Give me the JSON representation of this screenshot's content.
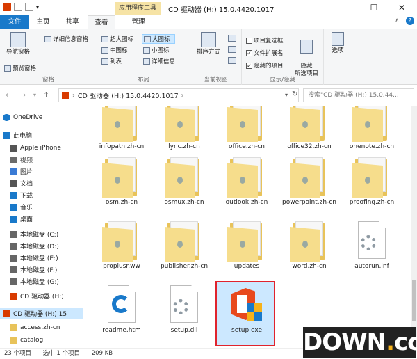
{
  "titlebar": {
    "context_tab": "应用程序工具",
    "title": "CD 驱动器 (H:) 15.0.4420.1017",
    "minimize": "—",
    "maximize": "☐",
    "close": "✕"
  },
  "tabs": {
    "file": "文件",
    "home": "主页",
    "share": "共享",
    "view": "查看",
    "manage": "管理"
  },
  "ribbon": {
    "pane": {
      "nav_pane": "导航窗格",
      "preview_pane": "预览窗格",
      "details_pane": "详细信息窗格",
      "label": "窗格"
    },
    "layout": {
      "extra_large": "超大图标",
      "large": "大图标",
      "medium": "中图标",
      "small": "小图标",
      "list": "列表",
      "details": "详细信息",
      "label": "布局"
    },
    "current_view": {
      "sort_by": "排序方式",
      "label": "当前视图"
    },
    "show_hide": {
      "item_checkboxes": "项目复选框",
      "file_extensions": "文件扩展名",
      "hidden_items": "隐藏的项目",
      "hide_selected": "隐藏\n所选项目",
      "label": "显示/隐藏"
    },
    "options": "选项"
  },
  "address": {
    "path": "CD 驱动器 (H:) 15.0.4420.1017",
    "search_placeholder": "搜索\"CD 驱动器 (H:) 15.0.44..."
  },
  "nav": {
    "items": [
      {
        "label": "OneDrive"
      },
      {
        "label": "此电脑"
      },
      {
        "label": "Apple iPhone"
      },
      {
        "label": "视频"
      },
      {
        "label": "图片"
      },
      {
        "label": "文档"
      },
      {
        "label": "下载"
      },
      {
        "label": "音乐"
      },
      {
        "label": "桌面"
      },
      {
        "label": "本地磁盘 (C:)"
      },
      {
        "label": "本地磁盘 (D:)"
      },
      {
        "label": "本地磁盘 (E:)"
      },
      {
        "label": "本地磁盘 (F:)"
      },
      {
        "label": "本地磁盘 (G:)"
      },
      {
        "label": "CD 驱动器 (H:)"
      },
      {
        "label": "CD 驱动器 (H:) 15"
      },
      {
        "label": "access.zh-cn"
      },
      {
        "label": "catalog"
      }
    ]
  },
  "files": [
    {
      "name": "infopath.zh-cn",
      "kind": "folder"
    },
    {
      "name": "lync.zh-cn",
      "kind": "folder"
    },
    {
      "name": "office.zh-cn",
      "kind": "folder"
    },
    {
      "name": "office32.zh-cn",
      "kind": "folder"
    },
    {
      "name": "onenote.zh-cn",
      "kind": "folder"
    },
    {
      "name": "osm.zh-cn",
      "kind": "folder"
    },
    {
      "name": "osmux.zh-cn",
      "kind": "folder"
    },
    {
      "name": "outlook.zh-cn",
      "kind": "folder"
    },
    {
      "name": "powerpoint.zh-cn",
      "kind": "folder"
    },
    {
      "name": "proofing.zh-cn",
      "kind": "folder"
    },
    {
      "name": "proplusr.ww",
      "kind": "folder"
    },
    {
      "name": "publisher.zh-cn",
      "kind": "folder"
    },
    {
      "name": "updates",
      "kind": "folder"
    },
    {
      "name": "word.zh-cn",
      "kind": "folder"
    },
    {
      "name": "autorun.inf",
      "kind": "settings-file"
    },
    {
      "name": "readme.htm",
      "kind": "edge-file"
    },
    {
      "name": "setup.dll",
      "kind": "settings-file"
    },
    {
      "name": "setup.exe",
      "kind": "office-exe"
    }
  ],
  "status": {
    "count": "23 个项目",
    "selected": "选中 1 个项目",
    "size": "209 KB"
  },
  "watermark": {
    "main": "DOWN",
    "dot": ".",
    "cc": "cc"
  },
  "colors": {
    "accent": "#1979ca",
    "selection": "#cce8ff",
    "highlight_border": "#e0232d",
    "folder": "#f6dd8c"
  }
}
